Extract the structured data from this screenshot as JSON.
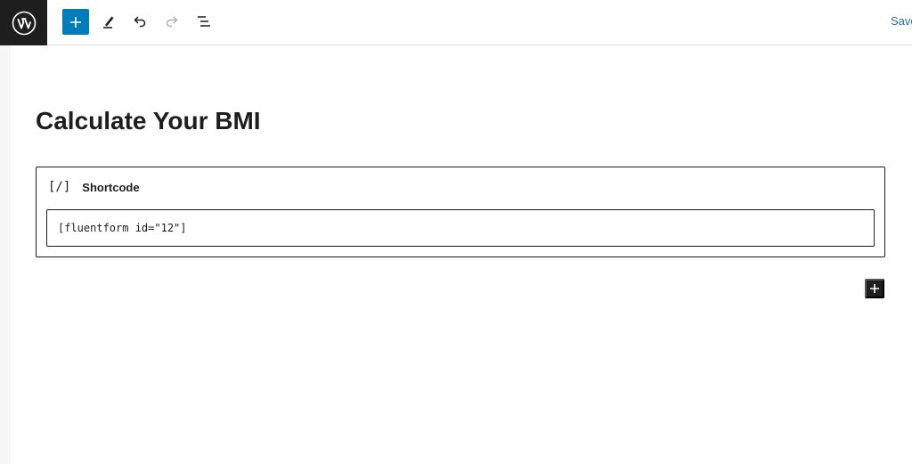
{
  "toolbar": {
    "logo_icon": "wordpress-logo-icon",
    "inserter_icon": "plus-icon",
    "tools_icon": "pencil-icon",
    "undo_icon": "undo-icon",
    "redo_icon": "redo-icon",
    "list_view_icon": "list-view-icon",
    "save_label": "Save",
    "accent_color": "#007cba"
  },
  "content": {
    "title": "Calculate Your BMI",
    "shortcode_block": {
      "icon_text": "[/]",
      "label": "Shortcode",
      "value": "[fluentform id=\"12\"]"
    },
    "append_icon": "plus-icon"
  }
}
